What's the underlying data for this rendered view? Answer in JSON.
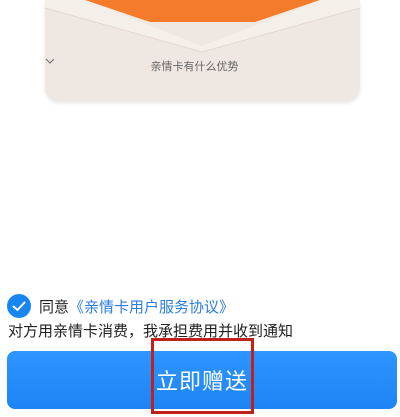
{
  "card": {
    "advantage_link": "亲情卡有什么优势",
    "advantage_icon": "chevron-down-icon",
    "accent_color": "#f47b2a"
  },
  "agreement": {
    "prefix": "同意",
    "link_text": "《亲情卡用户服务协议》",
    "checked": true,
    "check_icon": "checkmark-icon"
  },
  "notice": "对方用亲情卡消费，我承担费用并收到通知",
  "submit": {
    "label": "立即赠送",
    "color": "#1e84f5"
  },
  "highlight_color": "#c0221b"
}
